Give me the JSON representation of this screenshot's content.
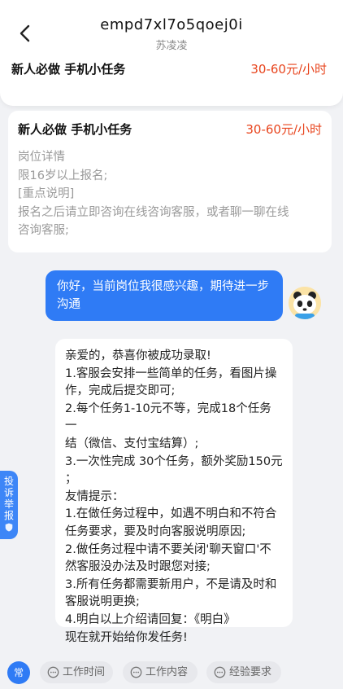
{
  "header": {
    "title": "empd7xl7o5qoej0i",
    "subtitle": "苏凌凌",
    "job_name": "新人必做 手机小任务",
    "job_pay": "30-60元/小时"
  },
  "job_card": {
    "name": "新人必做 手机小任务",
    "pay": "30-60元/小时",
    "lines": [
      "岗位详情",
      "限16岁以上报名;",
      "[重点说明]",
      "报名之后请立即咨询在线咨询客服，或者聊一聊在线",
      "咨询客服;"
    ]
  },
  "messages": {
    "me": [
      "你好，当前岗位我很感兴趣，期待进一步",
      "沟通"
    ],
    "them": [
      "亲爱的，恭喜你被成功录取!",
      "1.客服会安排一些简单的任务，看图片操",
      "作，完成后提交即可;",
      "2.每个任务1-10元不等，完成18个任务一",
      "结（微信、支付宝结算）;",
      "3.一次性完成 30个任务，额外奖励150元",
      "；",
      "友情提示：",
      "1.在做任务过程中，如遇不明白和不符合",
      "任务要求，要及时向客服说明原因;",
      "2.做任务过程中请不要关闭'聊天窗口'不",
      "然客服没办法及时跟您对接;",
      "3.所有任务都需要新用户，不是请及时和",
      "客服说明更换;",
      "4.明白以上介绍请回复：《明白》",
      "现在就开始给你发任务!"
    ]
  },
  "side_tab": {
    "label_chars": [
      "投",
      "诉",
      "举",
      "报"
    ]
  },
  "quick_replies": {
    "common": "常",
    "chips": [
      "工作时间",
      "工作内容",
      "经验要求"
    ]
  },
  "colors": {
    "accent": "#2f7bf5",
    "pay": "#e8451e",
    "background": "#f1f2f5"
  }
}
